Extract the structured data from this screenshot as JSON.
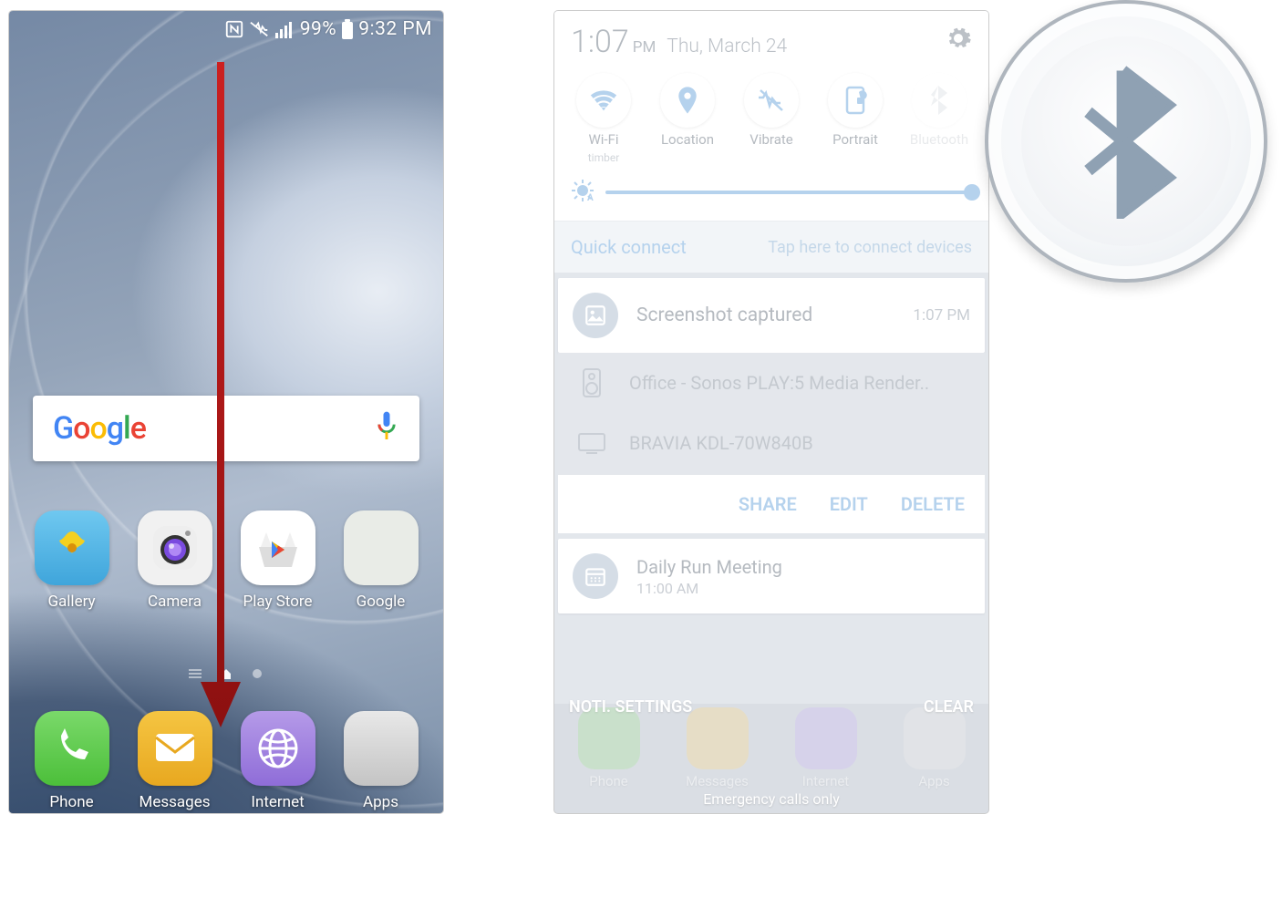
{
  "left": {
    "status": {
      "battery_pct": "99%",
      "time": "9:32 PM"
    },
    "search": {
      "logo_letters": [
        "G",
        "o",
        "o",
        "g",
        "l",
        "e"
      ]
    },
    "apps_row1": [
      {
        "id": "gallery",
        "label": "Gallery"
      },
      {
        "id": "camera",
        "label": "Camera"
      },
      {
        "id": "playstore",
        "label": "Play Store"
      },
      {
        "id": "google",
        "label": "Google"
      }
    ],
    "apps_row2": [
      {
        "id": "phone",
        "label": "Phone"
      },
      {
        "id": "messages",
        "label": "Messages"
      },
      {
        "id": "internet",
        "label": "Internet"
      },
      {
        "id": "apps",
        "label": "Apps"
      }
    ]
  },
  "right": {
    "header": {
      "time": "1:07",
      "ampm": "PM",
      "date": "Thu, March 24"
    },
    "qs": [
      {
        "id": "wifi",
        "label": "Wi-Fi",
        "sub": "timber"
      },
      {
        "id": "location",
        "label": "Location"
      },
      {
        "id": "vibrate",
        "label": "Vibrate"
      },
      {
        "id": "portrait",
        "label": "Portrait"
      },
      {
        "id": "bluetooth",
        "label": "Bluetooth"
      }
    ],
    "quick_connect": {
      "title": "Quick connect",
      "hint": "Tap here to connect devices"
    },
    "notif1": {
      "title": "Screenshot captured",
      "time": "1:07 PM"
    },
    "devices": [
      "Office - Sonos PLAY:5 Media Render..",
      "BRAVIA KDL-70W840B"
    ],
    "actions": {
      "share": "SHARE",
      "edit": "EDIT",
      "delete": "DELETE"
    },
    "notif2": {
      "title": "Daily Run Meeting",
      "sub": "11:00 AM"
    },
    "footer": {
      "left": "NOTI. SETTINGS",
      "right": "CLEAR"
    },
    "dock": [
      {
        "id": "phone",
        "label": "Phone"
      },
      {
        "id": "messages",
        "label": "Messages"
      },
      {
        "id": "internet",
        "label": "Internet"
      },
      {
        "id": "apps",
        "label": "Apps"
      }
    ],
    "emergency": "Emergency calls only"
  }
}
